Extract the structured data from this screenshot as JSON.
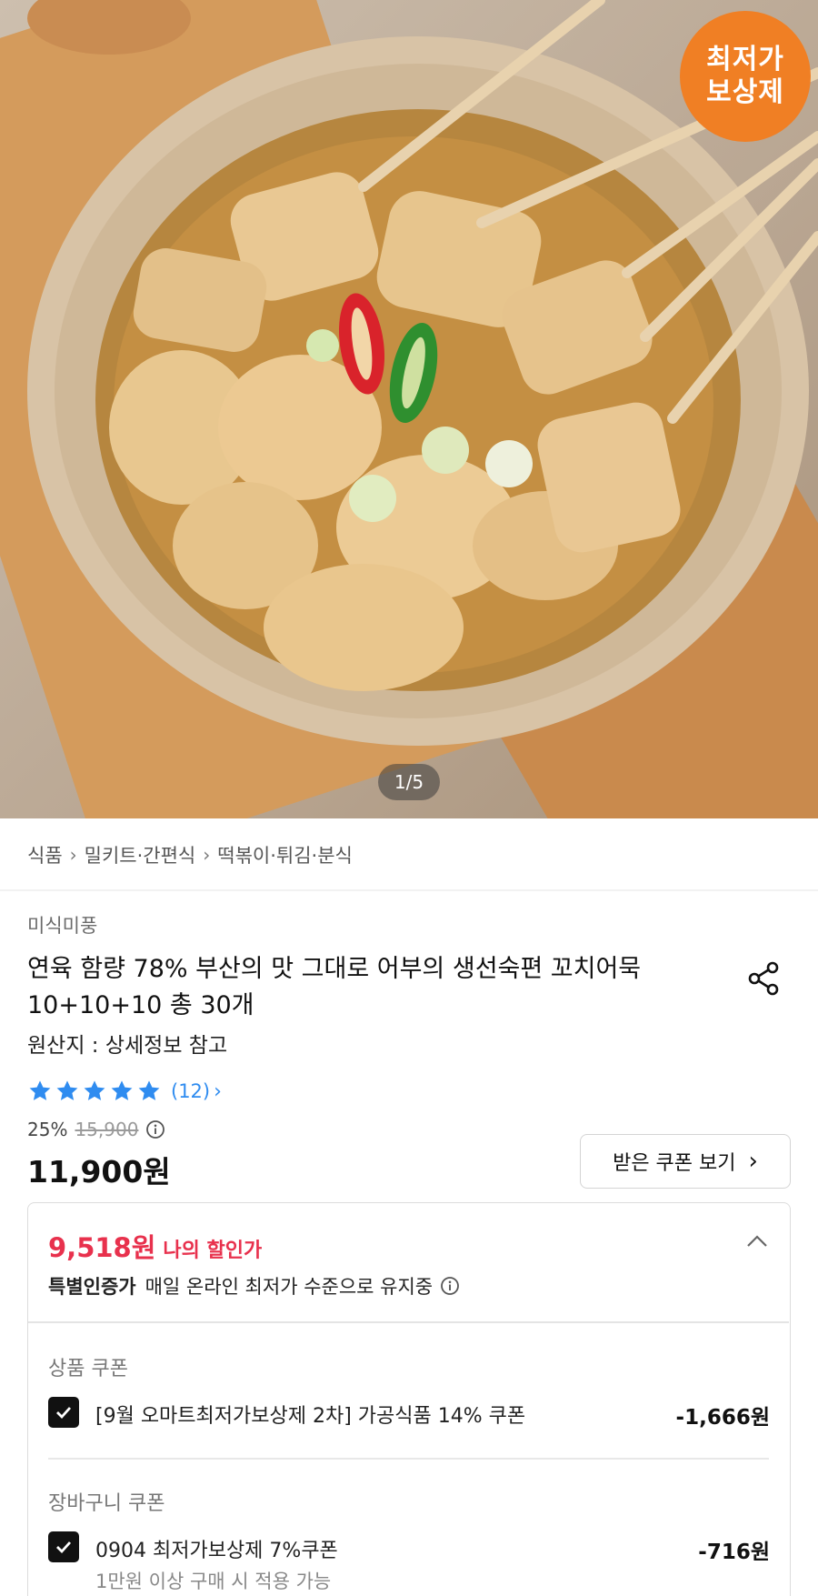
{
  "hero": {
    "badge_line1": "최저가",
    "badge_line2": "보상제",
    "counter": "1/5"
  },
  "breadcrumb": [
    "식품",
    "밀키트·간편식",
    "떡볶이·튀김·분식"
  ],
  "product": {
    "brand": "미식미풍",
    "title_line1": "연육 함량 78% 부산의 맛 그대로 어부의 생선숙편 꼬치어묵",
    "title_line2": "10+10+10 총 30개",
    "origin": "원산지 : 상세정보 참고",
    "rating_value": 5,
    "review_count": "(12)",
    "discount_rate": "25%",
    "original_price": "15,900",
    "price": "11,900원",
    "coupon_button_label": "받은 쿠폰 보기"
  },
  "benefit_box": {
    "my_price": "9,518원",
    "my_price_label": "나의 할인가",
    "cert_label": "특별인증가",
    "cert_text": "매일 온라인 최저가 수준으로 유지중",
    "product_coupon_section": "상품 쿠폰",
    "product_coupon_name": "[9월 오마트최저가보상제 2차] 가공식품 14% 쿠폰",
    "product_coupon_amount": "-1,666원",
    "cart_coupon_section": "장바구니 쿠폰",
    "cart_coupon_name": "0904 최저가보상제 7%쿠폰",
    "cart_coupon_amount": "-716원",
    "cart_coupon_condition": "1만원 이상 구매 시 적용 가능"
  },
  "colors": {
    "badge": "#f07f24",
    "star": "#2f8cf0",
    "discount_price": "#e8314d",
    "check": "#111111"
  },
  "icons": [
    "share-icon",
    "info-icon",
    "chevron-right-icon",
    "chevron-up-icon",
    "check-icon",
    "star-icon"
  ]
}
